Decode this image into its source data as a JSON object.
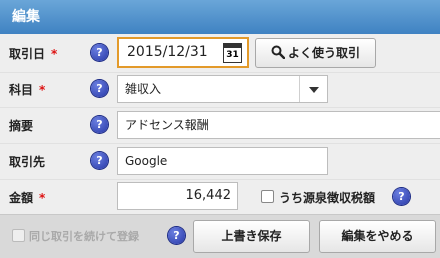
{
  "title": "編集",
  "fields": {
    "date": {
      "label": "取引日",
      "required_mark": "*",
      "value": "2015/12/31"
    },
    "account": {
      "label": "科目",
      "required_mark": "*",
      "value": "雑収入"
    },
    "description": {
      "label": "摘要",
      "value": "アドセンス報酬"
    },
    "partner": {
      "label": "取引先",
      "value": "Google"
    },
    "amount": {
      "label": "金額",
      "required_mark": "*",
      "value": "16,442"
    }
  },
  "buttons": {
    "frequent": "よく使う取引",
    "save": "上書き保存",
    "cancel": "編集をやめる"
  },
  "withholding_label": "うち源泉徴収税額",
  "continue_label": "同じ取引を続けて登録",
  "calendar_day": "31",
  "help_glyph": "?",
  "colors": {
    "title_bar": "#4a8ccb",
    "required": "#dd1111",
    "focus_border": "#e39a2a"
  },
  "icons": [
    "calendar-icon",
    "search-icon",
    "help-icon",
    "dropdown-arrow-icon"
  ]
}
